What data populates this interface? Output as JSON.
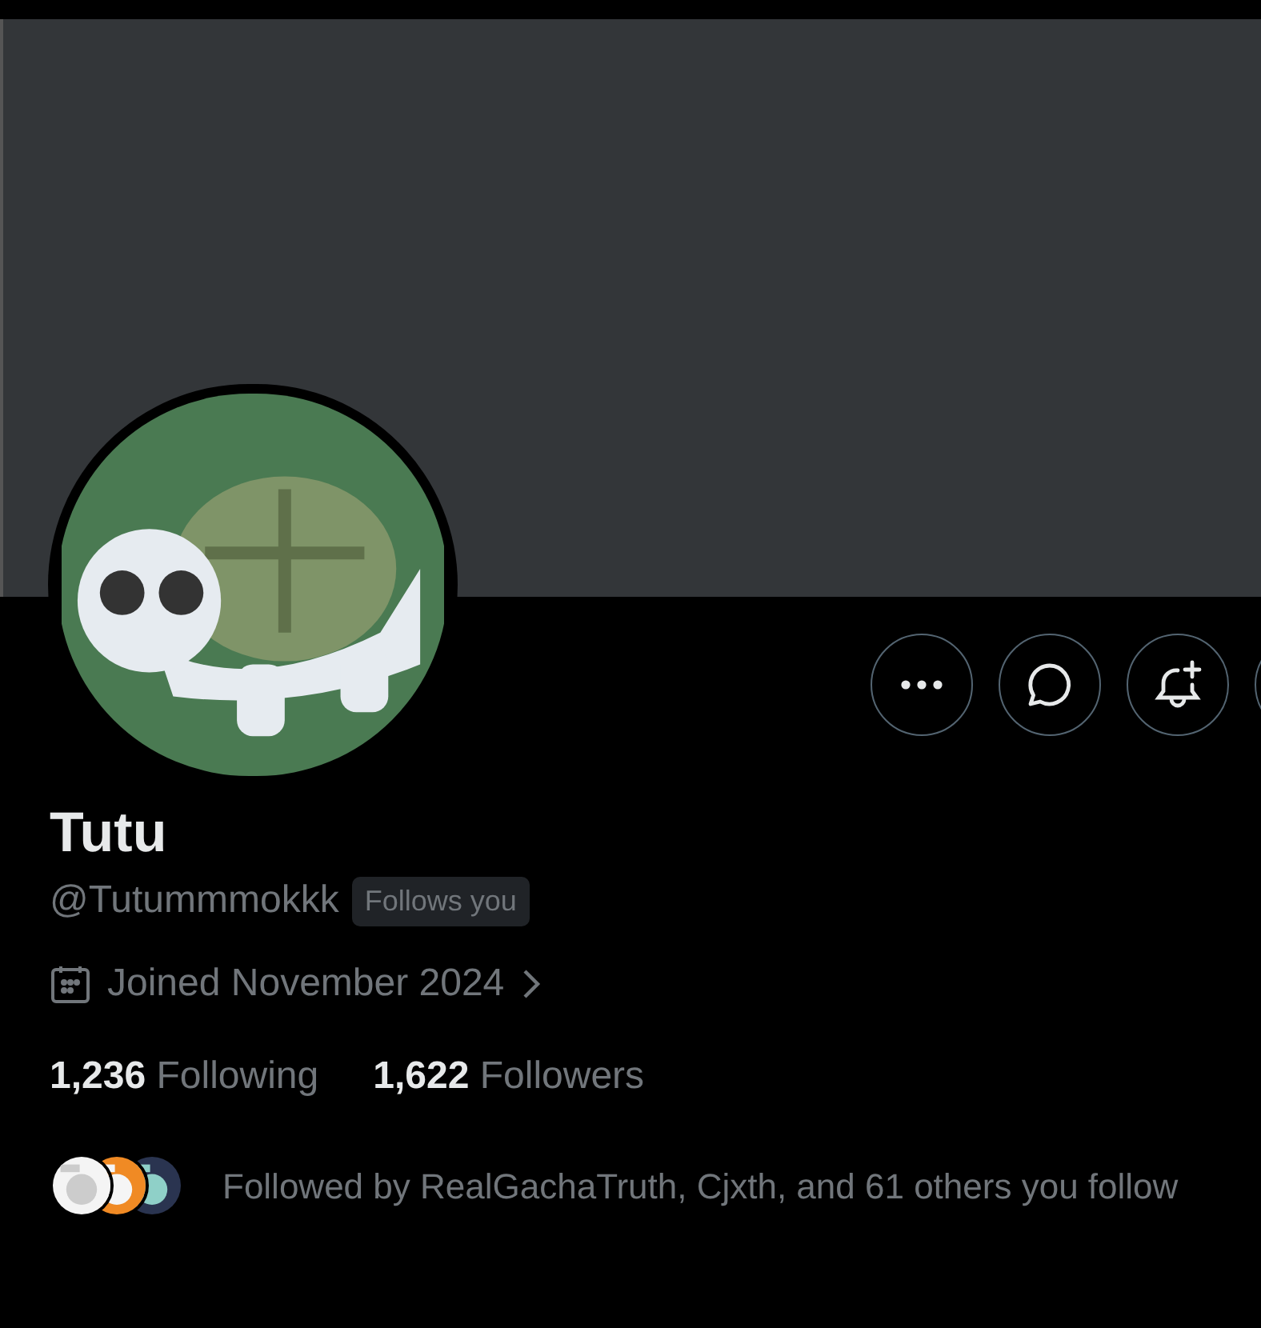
{
  "profile": {
    "name": "Tutu",
    "handle": "@Tutummmokkk",
    "follows_you": "Follows you",
    "joined": "Joined November 2024",
    "following_count": "1,236",
    "following_label": "Following",
    "followers_count": "1,622",
    "followers_label": "Followers",
    "followed_by": "Followed by RealGachaTruth, Cjxth, and 61 others you follow"
  },
  "actions": [
    {
      "kind": "more"
    },
    {
      "kind": "message"
    },
    {
      "kind": "notify"
    },
    {
      "kind": "partial"
    }
  ]
}
